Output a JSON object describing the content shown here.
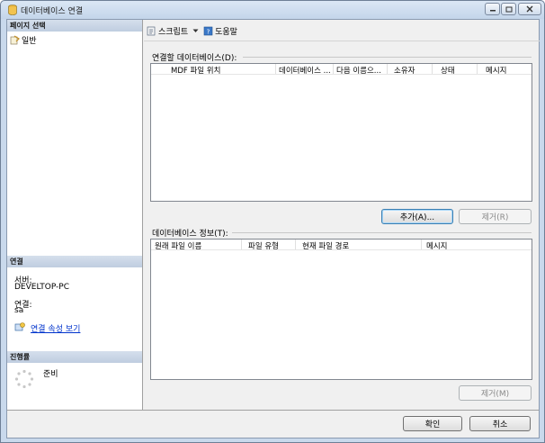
{
  "window": {
    "title": "데이터베이스 연결"
  },
  "left": {
    "select_page_header": "페이지 선택",
    "pages": [
      {
        "label": "일반",
        "icon": "general-page-icon"
      }
    ],
    "connection_header": "연결",
    "server_label": "서버:",
    "server_value": "DEVELTOP-PC",
    "connection_label": "연결:",
    "connection_value": "sa",
    "view_props_link": "연결 속성 보기",
    "progress_header": "진행률",
    "progress_status": "준비"
  },
  "toolbar": {
    "script_label": "스크립트",
    "help_label": "도움말"
  },
  "attach": {
    "label": "연결할 데이터베이스(D):",
    "columns": [
      "MDF 파일 위치",
      "데이터베이스 ...",
      "다음 이름으...",
      "소유자",
      "상태",
      "메시지"
    ],
    "rows": [],
    "add_button": "추가(A)...",
    "remove_button": "제거(R)"
  },
  "details": {
    "label": "데이터베이스 정보(T):",
    "columns": [
      "원래 파일 이름",
      "파일 유형",
      "현재 파일 경로",
      "메시지"
    ],
    "rows": [],
    "remove_button": "제거(M)"
  },
  "footer": {
    "ok_button": "확인",
    "cancel_button": "취소"
  },
  "colors": {
    "link": "#0033cc",
    "section_header": "#c7d3e3",
    "window_frame": "#c9d9ec"
  }
}
